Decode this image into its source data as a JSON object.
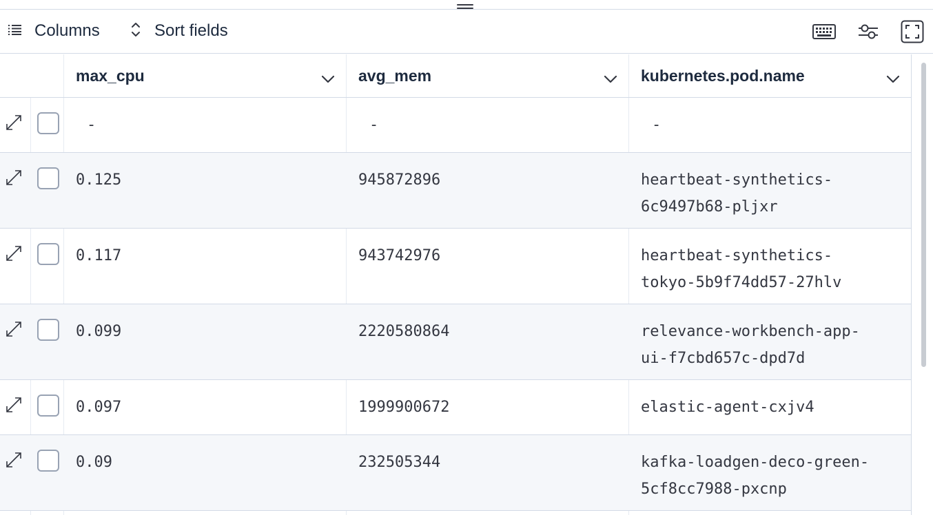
{
  "toolbar": {
    "columns_label": "Columns",
    "sort_label": "Sort fields",
    "icons": [
      "list-icon",
      "sort-icon",
      "keyboard-icon",
      "settings-sliders-icon",
      "fullscreen-icon"
    ]
  },
  "columns": [
    {
      "label": "max_cpu"
    },
    {
      "label": "avg_mem"
    },
    {
      "label": "kubernetes.pod.name"
    }
  ],
  "rows": [
    {
      "max_cpu": "-",
      "avg_mem": "-",
      "pod_line1": "-",
      "pod_line2": ""
    },
    {
      "max_cpu": "0.125",
      "avg_mem": "945872896",
      "pod_line1": "heartbeat-synthetics-",
      "pod_line2": "6c9497b68-pljxr"
    },
    {
      "max_cpu": "0.117",
      "avg_mem": "943742976",
      "pod_line1": "heartbeat-synthetics-",
      "pod_line2": "tokyo-5b9f74dd57-27hlv"
    },
    {
      "max_cpu": "0.099",
      "avg_mem": "2220580864",
      "pod_line1": "relevance-workbench-app-",
      "pod_line2": "ui-f7cbd657c-dpd7d"
    },
    {
      "max_cpu": "0.097",
      "avg_mem": "1999900672",
      "pod_line1": "elastic-agent-cxjv4",
      "pod_line2": ""
    },
    {
      "max_cpu": "0.09",
      "avg_mem": "232505344",
      "pod_line1": "kafka-loadgen-deco-green-",
      "pod_line2": "5cf8cc7988-pxcnp"
    }
  ],
  "colors": {
    "border": "#d3dae6",
    "alt_row": "#f5f7fa",
    "text": "#343741",
    "header_text": "#1d2a3e"
  }
}
